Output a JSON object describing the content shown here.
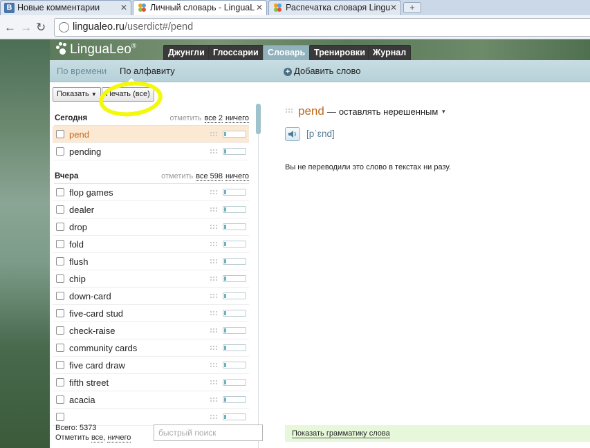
{
  "browser": {
    "tabs": [
      {
        "title": "Новые комментарии",
        "icon": "vk-icon",
        "active": false
      },
      {
        "title": "Личный словарь - LinguaL",
        "icon": "lingualeo-icon",
        "active": true
      },
      {
        "title": "Распечатка словаря Lingu",
        "icon": "lingualeo-icon",
        "active": false
      }
    ],
    "vk_letter": "В",
    "address_host": "lingualeo.ru",
    "address_path": "/userdict#/pend"
  },
  "site": {
    "logo": "LinguaLeo",
    "logo_mark": "®",
    "nav": [
      "Джунгли",
      "Глоссарии",
      "Словарь",
      "Тренировки",
      "Журнал"
    ],
    "nav_active": "Словарь"
  },
  "subnav": {
    "by_time": "По времени",
    "by_alpha": "По алфавиту",
    "add_word": "Добавить слово"
  },
  "toolbar": {
    "show": "Показать",
    "print_all": "Печать (все)"
  },
  "groups": [
    {
      "title": "Сегодня",
      "mark_label": "отметить",
      "all_label": "все 2",
      "none_label": "ничего",
      "words": [
        {
          "text": "pend",
          "selected": true
        },
        {
          "text": "pending",
          "selected": false
        }
      ]
    },
    {
      "title": "Вчера",
      "mark_label": "отметить",
      "all_label": "все 598",
      "none_label": "ничего",
      "words": [
        {
          "text": "flop games"
        },
        {
          "text": "dealer"
        },
        {
          "text": "drop"
        },
        {
          "text": "fold"
        },
        {
          "text": "flush"
        },
        {
          "text": "chip"
        },
        {
          "text": "down-card"
        },
        {
          "text": "five-card stud"
        },
        {
          "text": "check-raise"
        },
        {
          "text": "community cards"
        },
        {
          "text": "five card draw"
        },
        {
          "text": "fifth street"
        },
        {
          "text": "acacia"
        },
        {
          "text": ""
        }
      ]
    }
  ],
  "footer": {
    "total": "Всего: 5373",
    "mark": "Отметить",
    "all": "все",
    "none": "ничего",
    "search_placeholder": "быстрый поиск"
  },
  "detail": {
    "word": "pend",
    "dash": "—",
    "translation": "оставлять нерешенным",
    "transcription": "[pˈɛnd]",
    "note": "Вы не переводили это слово в текстах ни разу.",
    "grammar_link": "Показать грамматику слова"
  },
  "colors": {
    "accent_orange": "#c16a1f",
    "highlight_yellow": "#f4f80a",
    "subnav_bg": "#b7d1d9",
    "grammar_bg": "#e6f8d9"
  }
}
